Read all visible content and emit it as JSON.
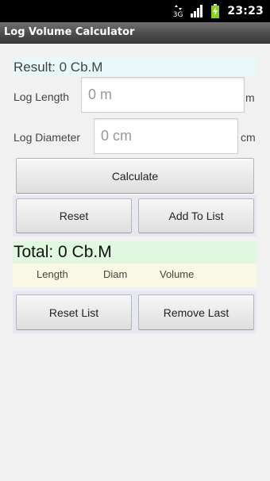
{
  "status_bar": {
    "network": "3G",
    "time": "23:23"
  },
  "app": {
    "title": "Log Volume Calculator"
  },
  "result": {
    "text": "Result: 0 Cb.M"
  },
  "log_length": {
    "label": "Log Length",
    "placeholder": "0 m",
    "unit": "m"
  },
  "log_diameter": {
    "label": "Log Diameter",
    "placeholder": "0 cm",
    "unit": "cm"
  },
  "buttons": {
    "calculate": "Calculate",
    "reset": "Reset",
    "add_to_list": "Add To List",
    "reset_list": "Reset List",
    "remove_last": "Remove Last"
  },
  "total": {
    "text": "Total: 0 Cb.M"
  },
  "list_columns": [
    "Length",
    "Diam",
    "Volume"
  ],
  "colors": {
    "result_bg": "#e8f8f8",
    "total_bg": "#e0f7e0",
    "list_header_bg": "#f8f8e4",
    "button_panel_bg": "#e6e8f2",
    "battery_green": "#8bd21a"
  }
}
